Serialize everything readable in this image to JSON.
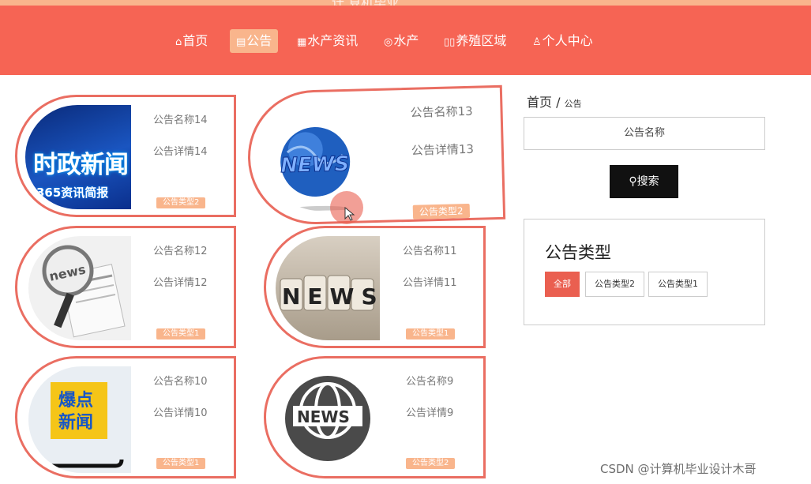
{
  "header": {
    "site_title_partial": "计 算机毕业",
    "nav": [
      {
        "label": "首页",
        "icon": "home-icon",
        "glyph": "⌂"
      },
      {
        "label": "公告",
        "icon": "gift-icon",
        "glyph": "▤"
      },
      {
        "label": "水产资讯",
        "icon": "grid-icon",
        "glyph": "▦"
      },
      {
        "label": "水产",
        "icon": "fish-icon",
        "glyph": "◎"
      },
      {
        "label": "养殖区域",
        "icon": "columns-icon",
        "glyph": "▯▯"
      },
      {
        "label": "个人中心",
        "icon": "user-icon",
        "glyph": "♙"
      }
    ]
  },
  "cards": [
    {
      "name": "公告名称14",
      "detail": "公告详情14",
      "tag": "公告类型2",
      "thumb": {
        "line1": "时政新闻",
        "line2": "365资讯简报"
      }
    },
    {
      "name": "公告名称13",
      "detail": "公告详情13",
      "tag": "公告类型2",
      "thumb": {
        "text": "NEWS"
      }
    },
    {
      "name": "公告名称12",
      "detail": "公告详情12",
      "tag": "公告类型1",
      "thumb": {
        "text": "news"
      }
    },
    {
      "name": "公告名称11",
      "detail": "公告详情11",
      "tag": "公告类型1",
      "thumb": {
        "text": "NEWS"
      }
    },
    {
      "name": "公告名称10",
      "detail": "公告详情10",
      "tag": "公告类型1",
      "thumb": {
        "line1": "爆点",
        "line2": "新闻"
      }
    },
    {
      "name": "公告名称9",
      "detail": "公告详情9",
      "tag": "公告类型2",
      "thumb": {
        "text": "NEWS"
      }
    }
  ],
  "sidebar": {
    "breadcrumb_home": "首页",
    "breadcrumb_sep": "/",
    "breadcrumb_current": "公告",
    "search_placeholder": "公告名称",
    "search_button": "搜索",
    "type_title": "公告类型",
    "type_buttons": [
      "全部",
      "公告类型2",
      "公告类型1"
    ]
  },
  "watermark": "CSDN @计算机毕业设计木哥",
  "colors": {
    "header": "#f66454",
    "accent": "#f9b58c",
    "card_border": "#ea6e62",
    "active_type": "#ea5f50",
    "search_button": "#111111"
  }
}
